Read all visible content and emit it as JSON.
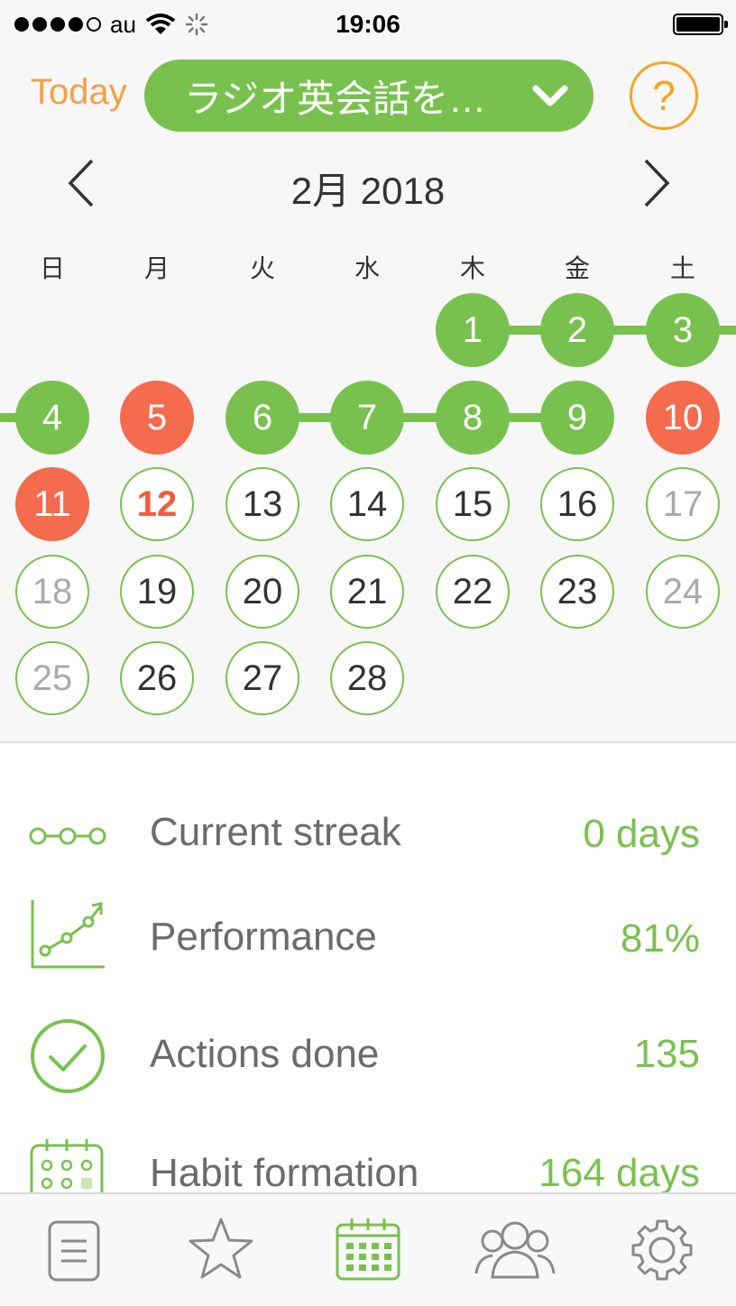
{
  "status_bar": {
    "carrier": "au",
    "time": "19:06",
    "signal_dots": [
      true,
      true,
      true,
      true,
      false
    ]
  },
  "header": {
    "today_label": "Today",
    "habit_title": "ラジオ英会話を…",
    "help_label": "?"
  },
  "calendar": {
    "month_label": "2月 2018",
    "weekdays": [
      "日",
      "月",
      "火",
      "水",
      "木",
      "金",
      "土"
    ],
    "first_weekday_index": 4,
    "days": [
      {
        "label": "1",
        "status": "done"
      },
      {
        "label": "2",
        "status": "done"
      },
      {
        "label": "3",
        "status": "done"
      },
      {
        "label": "4",
        "status": "done"
      },
      {
        "label": "5",
        "status": "missed"
      },
      {
        "label": "6",
        "status": "done"
      },
      {
        "label": "7",
        "status": "done"
      },
      {
        "label": "8",
        "status": "done"
      },
      {
        "label": "9",
        "status": "done"
      },
      {
        "label": "10",
        "status": "missed"
      },
      {
        "label": "11",
        "status": "missed"
      },
      {
        "label": "12",
        "status": "today"
      },
      {
        "label": "13",
        "status": "future"
      },
      {
        "label": "14",
        "status": "future"
      },
      {
        "label": "15",
        "status": "future"
      },
      {
        "label": "16",
        "status": "future"
      },
      {
        "label": "17",
        "status": "future"
      },
      {
        "label": "18",
        "status": "future"
      },
      {
        "label": "19",
        "status": "future"
      },
      {
        "label": "20",
        "status": "future"
      },
      {
        "label": "21",
        "status": "future"
      },
      {
        "label": "22",
        "status": "future"
      },
      {
        "label": "23",
        "status": "future"
      },
      {
        "label": "24",
        "status": "future"
      },
      {
        "label": "25",
        "status": "future"
      },
      {
        "label": "26",
        "status": "future"
      },
      {
        "label": "27",
        "status": "future"
      },
      {
        "label": "28",
        "status": "future"
      }
    ]
  },
  "stats": [
    {
      "icon": "streak-icon",
      "label": "Current streak",
      "value": "0 days"
    },
    {
      "icon": "performance-chart-icon",
      "label": "Performance",
      "value": "81%"
    },
    {
      "icon": "checkmark-circle-icon",
      "label": "Actions done",
      "value": "135"
    },
    {
      "icon": "calendar-grid-icon",
      "label": "Habit formation",
      "value": "164 days"
    }
  ],
  "tabs": [
    {
      "icon": "list-icon",
      "active": false
    },
    {
      "icon": "star-icon",
      "active": false
    },
    {
      "icon": "calendar-icon",
      "active": true
    },
    {
      "icon": "group-icon",
      "active": false
    },
    {
      "icon": "settings-gear-icon",
      "active": false
    }
  ],
  "colors": {
    "accent_green": "#79c14f",
    "missed_red": "#f46b4d",
    "today_orange": "#f5a04a",
    "help_orange": "#f5a523"
  }
}
